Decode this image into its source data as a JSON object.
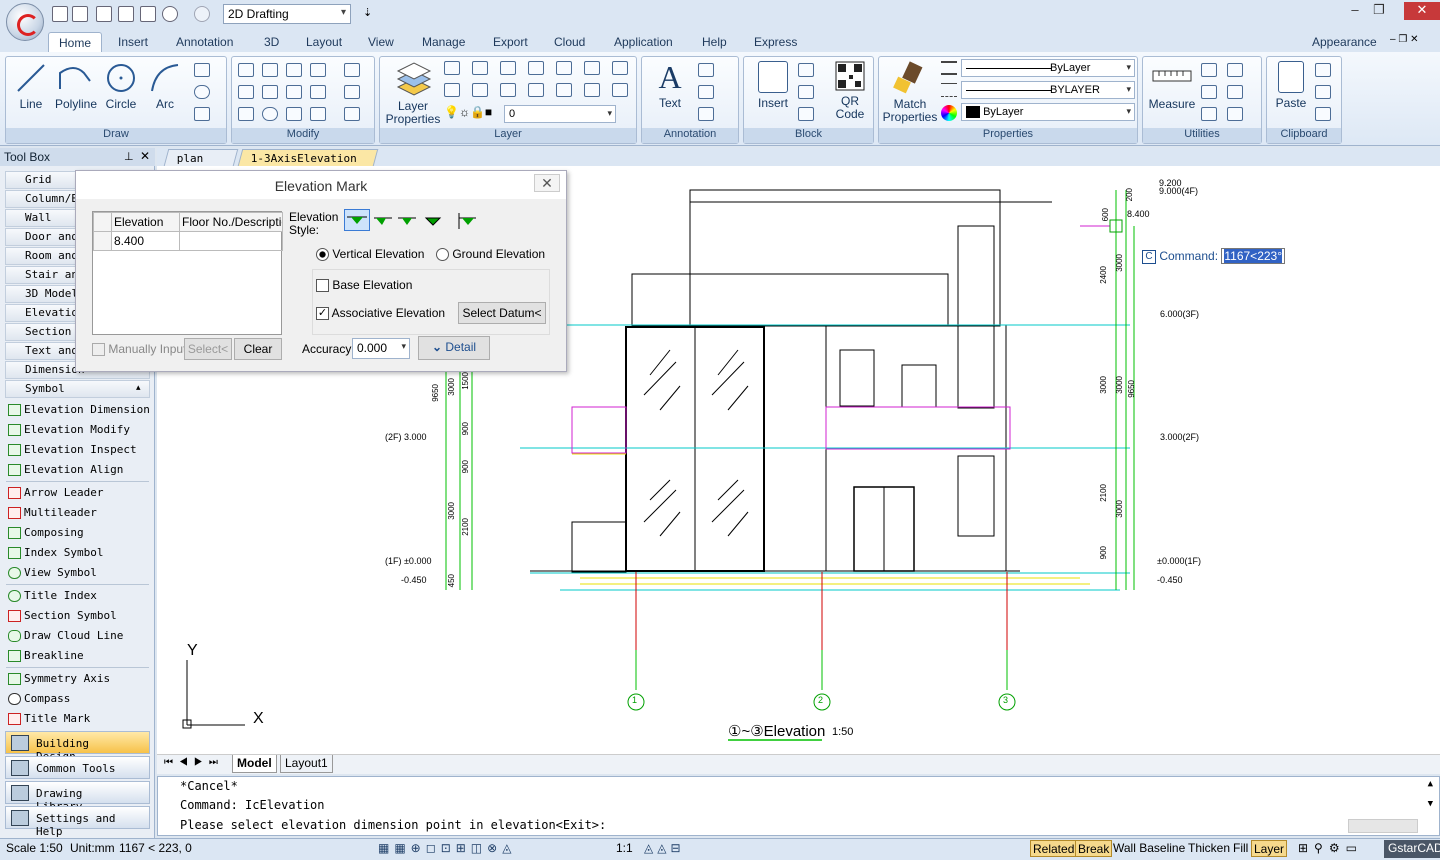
{
  "app": {
    "workspace": "2D Drafting"
  },
  "ribbon_tabs": [
    "Home",
    "Insert",
    "Annotation",
    "3D",
    "Layout",
    "View",
    "Manage",
    "Export",
    "Cloud",
    "Application",
    "Help",
    "Express"
  ],
  "appearance": "Appearance",
  "panels": {
    "draw": {
      "title": "Draw",
      "buttons": [
        "Line",
        "Polyline",
        "Circle",
        "Arc"
      ]
    },
    "modify": {
      "title": "Modify"
    },
    "layer": {
      "title": "Layer",
      "button": "Layer\nProperties",
      "current": "0"
    },
    "annotation": {
      "title": "Annotation",
      "button": "Text"
    },
    "block": {
      "title": "Block",
      "buttons": [
        "Insert",
        "QR\nCode"
      ]
    },
    "properties": {
      "title": "Properties",
      "button": "Match\nProperties",
      "color": "ByLayer",
      "linetype": "BYLAYER",
      "lineweight": "ByLayer"
    },
    "utilities": {
      "title": "Utilities",
      "button": "Measure"
    },
    "clipboard": {
      "title": "Clipboard",
      "button": "Paste"
    }
  },
  "toolbox": {
    "title": "Tool Box",
    "categories": [
      "Grid",
      "Column/Beam",
      "Wall",
      "Door and Window",
      "Room and Roof",
      "Stair and Other",
      "3D Model",
      "Elevation",
      "Section",
      "Text and Table",
      "Dimension",
      "Symbol"
    ],
    "items": [
      "Elevation Dimension",
      "Elevation Modify",
      "Elevation Inspect",
      "Elevation Align",
      "Arrow Leader",
      "Multileader",
      "Composing",
      "Index Symbol",
      "View Symbol",
      "Title Index",
      "Section Symbol",
      "Draw Cloud Line",
      "Breakline",
      "Symmetry Axis",
      "Compass",
      "Title Mark"
    ],
    "bottom": [
      "Building Design",
      "Common Tools",
      "Drawing Library",
      "Settings and Help"
    ]
  },
  "doc_tabs": [
    "plan",
    "1-3AxisElevation"
  ],
  "dialog": {
    "title": "Elevation Mark",
    "col_elevation": "Elevation",
    "col_floor": "Floor No./Description",
    "row_value": "8.400",
    "style_label": "Elevation\nStyle:",
    "vertical": "Vertical Elevation",
    "ground": "Ground Elevation",
    "base": "Base Elevation",
    "assoc": "Associative Elevation",
    "select_datum": "Select Datum<",
    "manual": "Manually Input",
    "select": "Select<",
    "clear": "Clear",
    "accuracy_label": "Accuracy:",
    "accuracy": "0.000",
    "detail": "Detail"
  },
  "cmd_tip": {
    "label": "Command:",
    "value": "1167<223°"
  },
  "drawing": {
    "title": "①~③Elevation",
    "scale": "1:50",
    "axes": [
      "1",
      "2",
      "3"
    ],
    "levels_right": [
      "9.200",
      "9.000(4F)",
      "6.000(3F)",
      "3.000(2F)",
      "±0.000(1F)",
      "-0.450"
    ],
    "levels_left": [
      "(2F) 3.000",
      "(1F) ±0.000",
      "-0.450"
    ],
    "dims_right_inner": [
      "200",
      "600",
      "2400",
      "3000",
      "2100",
      "900"
    ],
    "dims_right_outer": [
      "3000",
      "3000",
      "3000"
    ],
    "dims_right_total": "9650",
    "dims_left": [
      "9650",
      "3000",
      "1500",
      "900",
      "900",
      "3000",
      "2100",
      "450"
    ],
    "tag": "8.400"
  },
  "model_tabs": [
    "Model",
    "Layout1"
  ],
  "command_lines": [
    "*Cancel*",
    "Command: IcElevation",
    "Please select elevation dimension point in elevation<Exit>:"
  ],
  "status": {
    "scale": "Scale 1:50",
    "unit": "Unit:mm",
    "coords": "1167 < 223, 0",
    "ratio": "1:1",
    "toggles": [
      "Related",
      "Break",
      "Wall Baseline",
      "Thicken",
      "Fill",
      "Layer"
    ],
    "brand": "GstarCAD"
  },
  "colors": {
    "accent": "#f7c24a",
    "dim": "#00c000",
    "grid": "#00c8c8",
    "magenta": "#d020d0",
    "axis_red": "#d00000"
  }
}
